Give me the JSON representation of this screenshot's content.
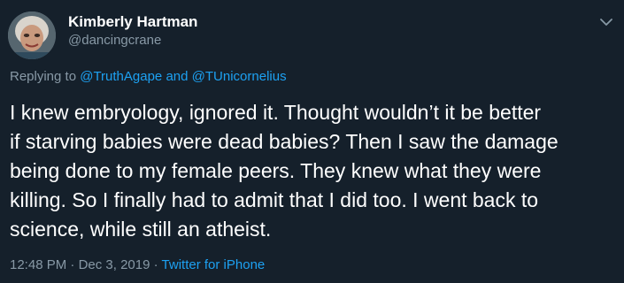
{
  "author": {
    "display_name": "Kimberly Hartman",
    "handle": "@dancingcrane"
  },
  "reply": {
    "prefix": "Replying to",
    "mention_1": "@TruthAgape",
    "conjunction": "and",
    "mention_2": "@TUnicornelius"
  },
  "tweet": {
    "lines": [
      "I knew embryology, ignored it. Thought wouldn’t it be better",
      "if starving babies were dead babies? Then I saw the damage",
      "being done to my female peers. They knew what they were",
      "killing. So I finally had to admit that I did too. I went back to",
      "science, while still an atheist."
    ]
  },
  "meta": {
    "time": "12:48 PM",
    "separator": "·",
    "date": "Dec 3, 2019",
    "separator_2": "·",
    "source": "Twitter for iPhone"
  },
  "icons": {
    "menu": "chevron-down-icon"
  },
  "colors": {
    "background": "#15202b",
    "primary_text": "#ffffff",
    "secondary_text": "#8899a6",
    "link": "#1da1f2"
  }
}
